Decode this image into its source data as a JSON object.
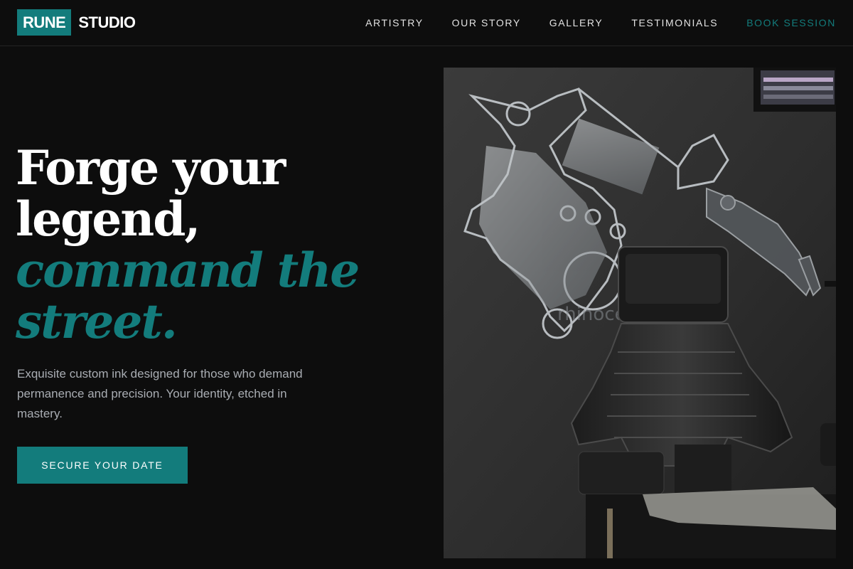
{
  "brand": {
    "logo_box": "RUNE",
    "logo_text": "STUDIO",
    "accent_color": "#137c7c"
  },
  "nav": {
    "items": [
      {
        "label": "ARTISTRY"
      },
      {
        "label": "OUR STORY"
      },
      {
        "label": "GALLERY"
      },
      {
        "label": "TESTIMONIALS"
      },
      {
        "label": "BOOK SESSION"
      }
    ]
  },
  "hero": {
    "headline_line1": "Forge your",
    "headline_line2": "legend,",
    "headline_line3": "command the",
    "headline_line4": "street.",
    "subtitle": "Exquisite custom ink designed for those who demand permanence and precision. Your identity, etched in mastery.",
    "cta_label": "SECURE YOUR DATE",
    "image": {
      "alt": "Tattoo chair in front of a wall mural of a tattoo machine and mechanical arm",
      "watermark": "rhinoceros.tokyo"
    }
  }
}
